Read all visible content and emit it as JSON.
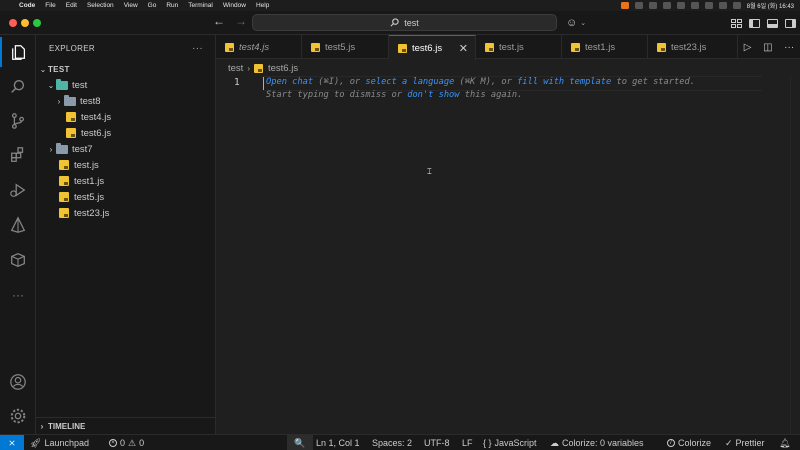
{
  "menubar": {
    "app": "Code",
    "items": [
      "File",
      "Edit",
      "Selection",
      "View",
      "Go",
      "Run",
      "Terminal",
      "Window",
      "Help"
    ],
    "clock": "8월 6일 (화) 16:43"
  },
  "titlebar": {
    "search_text": "test",
    "nav_back": "←",
    "nav_forward": "→"
  },
  "sidebar": {
    "header": "EXPLORER",
    "more": "···",
    "root": "TEST",
    "tree": [
      {
        "label": "test",
        "depth": 1,
        "kind": "folder-open"
      },
      {
        "label": "test8",
        "depth": 2,
        "kind": "folder"
      },
      {
        "label": "test4.js",
        "depth": 2,
        "kind": "js"
      },
      {
        "label": "test6.js",
        "depth": 2,
        "kind": "js"
      },
      {
        "label": "test7",
        "depth": 1,
        "kind": "folder"
      },
      {
        "label": "test.js",
        "depth": 1,
        "kind": "js"
      },
      {
        "label": "test1.js",
        "depth": 1,
        "kind": "js"
      },
      {
        "label": "test5.js",
        "depth": 1,
        "kind": "js"
      },
      {
        "label": "test23.js",
        "depth": 1,
        "kind": "js"
      }
    ],
    "timeline": "TIMELINE"
  },
  "tabs": [
    {
      "label": "test4.js",
      "italic": true,
      "active": false
    },
    {
      "label": "test5.js",
      "italic": false,
      "active": false
    },
    {
      "label": "test6.js",
      "italic": false,
      "active": true
    },
    {
      "label": "test.js",
      "italic": false,
      "active": false
    },
    {
      "label": "test1.js",
      "italic": false,
      "active": false
    },
    {
      "label": "test23.js",
      "italic": false,
      "active": false
    }
  ],
  "breadcrumb": {
    "folder": "test",
    "file": "test6.js"
  },
  "editor": {
    "line_number": "1",
    "hint_line1": {
      "open_chat": "Open chat",
      "open_chat_key": " (⌘I), or ",
      "select_language": "select a language",
      "select_language_key": " (⌘K M), or ",
      "fill_template": "fill with template",
      "tail": " to get started."
    },
    "hint_line2": {
      "start": "Start typing to dismiss or ",
      "dont_show": "don't show",
      "tail": " this again."
    }
  },
  "statusbar": {
    "remote": "⨯",
    "launchpad": "Launchpad",
    "errors": "0",
    "warnings": "0",
    "zoom": "🔍",
    "position": "Ln 1, Col 1",
    "spaces": "Spaces: 2",
    "encoding": "UTF-8",
    "eol": "LF",
    "language": "JavaScript",
    "colorize_vars": "Colorize: 0 variables",
    "colorize": "Colorize",
    "prettier": "Prettier"
  },
  "colors": {
    "accent": "#0078d4",
    "link": "#3794ff",
    "background": "#1f1f1f",
    "sidebar": "#181818",
    "js_icon": "#f1c232"
  }
}
